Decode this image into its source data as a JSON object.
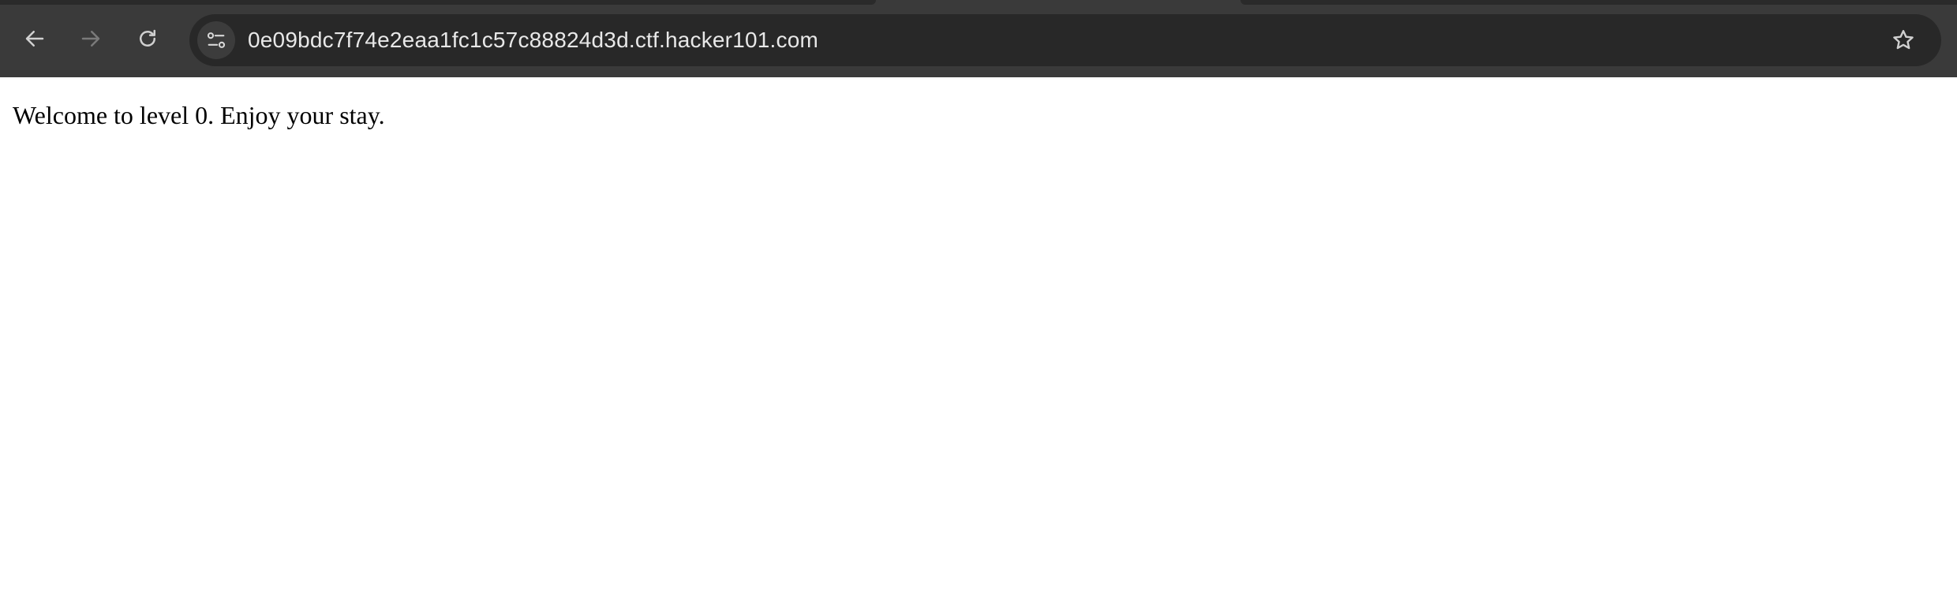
{
  "browser": {
    "toolbar": {
      "back_icon": "arrow-left-icon",
      "forward_icon": "arrow-right-icon",
      "reload_icon": "reload-icon"
    },
    "address_bar": {
      "site_info_icon": "tune-icon",
      "url": "0e09bdc7f74e2eaa1fc1c57c88824d3d.ctf.hacker101.com",
      "bookmark_icon": "star-outline-icon"
    },
    "colors": {
      "toolbar_bg": "#3a3a3a",
      "omnibox_bg": "#282828",
      "url_text": "#e8e8e8",
      "icon_enabled": "#d0d0d0",
      "icon_disabled": "#7a7a7a",
      "page_bg": "#ffffff"
    }
  },
  "page": {
    "body_text": "Welcome to level 0. Enjoy your stay."
  }
}
